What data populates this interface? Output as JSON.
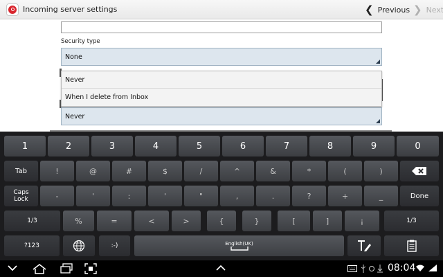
{
  "actionbar": {
    "title": "Incoming server settings",
    "previous_label": "Previous",
    "next_label": "Next",
    "app_icon": "email-app-icon"
  },
  "form": {
    "security_type_label": "Security type",
    "security_type_value": "None",
    "delete_policy_value": "Never",
    "dropdown_options": [
      "Never",
      "When I delete from Inbox"
    ]
  },
  "keyboard": {
    "row1": [
      "1",
      "2",
      "3",
      "4",
      "5",
      "6",
      "7",
      "8",
      "9",
      "0"
    ],
    "row2": [
      "!",
      "@",
      "#",
      "$",
      "/",
      "^",
      "&",
      "*",
      "(",
      ")"
    ],
    "row3": [
      "-",
      "'",
      ":",
      "'",
      "\"",
      ",",
      ".",
      "?",
      "+",
      "_"
    ],
    "row4": [
      "%",
      "=",
      "<",
      ">",
      "{",
      "}",
      "[",
      "]",
      "¡"
    ],
    "tab_label": "Tab",
    "caps_label_1": "Caps",
    "caps_label_2": "Lock",
    "done_label": "Done",
    "page_left_label": "1/3",
    "page_right_label": "1/3",
    "sym_label": "?123",
    "emoticon_label": ":-)",
    "space_label": "English(UK)"
  },
  "sysbar": {
    "time": "08:04"
  },
  "colors": {
    "spinner_bg": "#dde6ee",
    "keyboard_bg": "#1c1c1e",
    "app_icon_red": "#d9262e"
  }
}
